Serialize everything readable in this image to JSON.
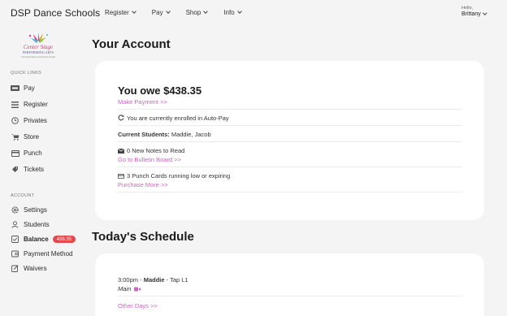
{
  "brand": "DSP Dance Schools",
  "nav": [
    {
      "label": "Register"
    },
    {
      "label": "Pay"
    },
    {
      "label": "Shop"
    },
    {
      "label": "Info"
    }
  ],
  "user": {
    "greeting": "Hello,",
    "name": "Brittany"
  },
  "logo": {
    "line1": "Center Stage",
    "line2": "PERFORMING ARTS",
    "tagline": "A Premier Dance and Fitness Studio"
  },
  "sidebar": {
    "quick_links_label": "QUICK LINKS",
    "quick_links": [
      {
        "label": "Pay",
        "icon": "visa-card-icon"
      },
      {
        "label": "Register",
        "icon": "list-icon"
      },
      {
        "label": "Privates",
        "icon": "clock-icon"
      },
      {
        "label": "Store",
        "icon": "cart-icon"
      },
      {
        "label": "Punch",
        "icon": "card-icon"
      },
      {
        "label": "Tickets",
        "icon": "ticket-icon"
      }
    ],
    "account_label": "ACCOUNT",
    "account": [
      {
        "label": "Settings",
        "icon": "gear-icon"
      },
      {
        "label": "Students",
        "icon": "user-icon"
      },
      {
        "label": "Balance",
        "icon": "check-square-icon",
        "badge": "438.35"
      },
      {
        "label": "Payment Method",
        "icon": "wallet-icon"
      },
      {
        "label": "Waivers",
        "icon": "edit-icon"
      }
    ]
  },
  "account_section": {
    "title": "Your Account",
    "owe": "You owe $438.35",
    "make_payment": "Make Payment >>",
    "autopay": "You are currently enrolled in Auto-Pay",
    "students_label": "Current Students:",
    "students_value": "Maddie, Jacob",
    "notes": "0 New Notes to Read",
    "bulletin_link": "Go to Bulletin Board >>",
    "punch": "3 Punch Cards running low or expiring",
    "purchase_link": "Purchase More >>"
  },
  "schedule_section": {
    "title": "Today's Schedule",
    "time": "3:00pm",
    "separator": " - ",
    "student": "Maddie",
    "class": " - Tap L1",
    "location": "Main",
    "other_days": "Other Days >>"
  },
  "colors": {
    "accent": "#d064c8",
    "badge": "#e5484d",
    "background": "#f4f4f5"
  }
}
